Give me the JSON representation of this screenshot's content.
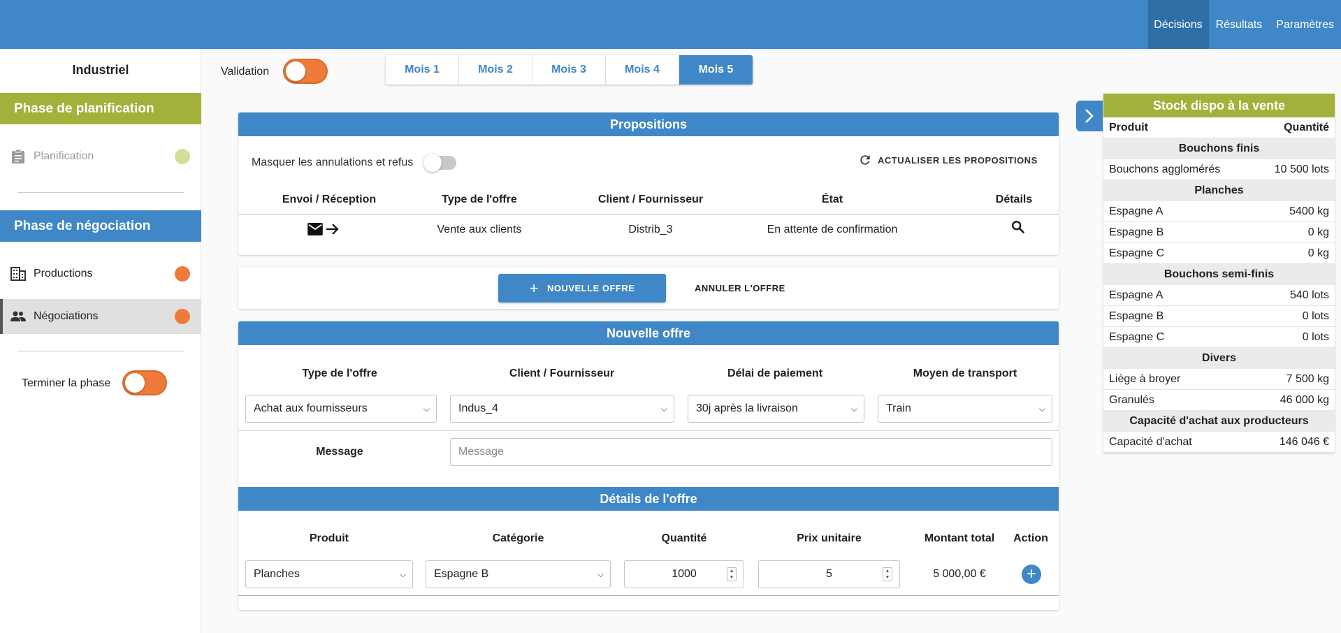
{
  "topnav": {
    "items": [
      "Décisions",
      "Résultats",
      "Paramètres"
    ]
  },
  "sidebar": {
    "title": "Industriel",
    "phase_planning": "Phase de planification",
    "planning_item": "Planification",
    "phase_negotiation": "Phase de négociation",
    "productions_item": "Productions",
    "negotiations_item": "Négociations",
    "finish_phase": "Terminer la phase",
    "colors": {
      "green": "#a3b03a",
      "blue": "#3f87c6",
      "orange": "#ee7b3a",
      "pale_green": "#d4dd9a"
    }
  },
  "validation": {
    "label": "Validation"
  },
  "months": [
    "Mois 1",
    "Mois 2",
    "Mois 3",
    "Mois 4",
    "Mois 5"
  ],
  "active_month": "Mois 5",
  "proposals": {
    "title": "Propositions",
    "hide_label": "Masquer les annulations et refus",
    "refresh_label": "ACTUALISER LES PROPOSITIONS",
    "columns": [
      "Envoi / Réception",
      "Type de l'offre",
      "Client / Fournisseur",
      "État",
      "Détails"
    ],
    "rows": [
      {
        "direction_icons": "mail-icon,arrow-right-icon",
        "type": "Vente aux clients",
        "partner": "Distrib_3",
        "state": "En attente de confirmation"
      }
    ]
  },
  "actions": {
    "new_offer": "NOUVELLE OFFRE",
    "cancel_offer": "ANNULER L'OFFRE"
  },
  "new_offer": {
    "title": "Nouvelle offre",
    "columns": [
      "Type de l'offre",
      "Client / Fournisseur",
      "Délai de paiement",
      "Moyen de transport"
    ],
    "offer_type": "Achat aux fournisseurs",
    "partner": "Indus_4",
    "payment_delay": "30j après la livraison",
    "transport": "Train",
    "message_label": "Message",
    "message_placeholder": "Message"
  },
  "details": {
    "title": "Détails de l'offre",
    "columns": [
      "Produit",
      "Catégorie",
      "Quantité",
      "Prix unitaire",
      "Montant total",
      "Action"
    ],
    "product": "Planches",
    "category": "Espagne B",
    "quantity": "1000",
    "unit_price": "5",
    "total": "5 000,00 €"
  },
  "stock": {
    "title": "Stock dispo à la vente",
    "col_product": "Produit",
    "col_quantity": "Quantité",
    "groups": [
      {
        "name": "Bouchons finis",
        "rows": [
          {
            "product": "Bouchons agglomérés",
            "qty": "10 500 lots"
          }
        ]
      },
      {
        "name": "Planches",
        "rows": [
          {
            "product": "Espagne A",
            "qty": "5400 kg"
          },
          {
            "product": "Espagne B",
            "qty": "0 kg"
          },
          {
            "product": "Espagne C",
            "qty": "0 kg"
          }
        ]
      },
      {
        "name": "Bouchons semi-finis",
        "rows": [
          {
            "product": "Espagne A",
            "qty": "540 lots"
          },
          {
            "product": "Espagne B",
            "qty": "0 lots"
          },
          {
            "product": "Espagne C",
            "qty": "0 lots"
          }
        ]
      },
      {
        "name": "Divers",
        "rows": [
          {
            "product": "Liège à broyer",
            "qty": "7 500 kg"
          },
          {
            "product": "Granulés",
            "qty": "46 000 kg"
          }
        ]
      },
      {
        "name": "Capacité d'achat aux producteurs",
        "rows": [
          {
            "product": "Capacité d'achat",
            "qty": "146 046 €"
          }
        ]
      }
    ]
  }
}
